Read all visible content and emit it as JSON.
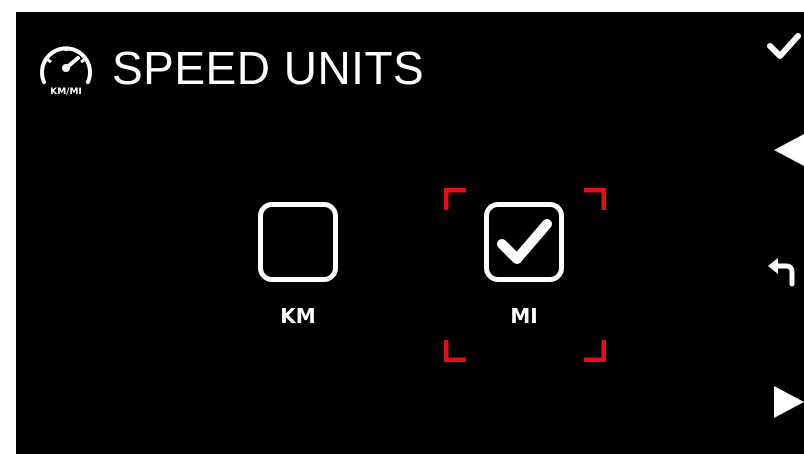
{
  "header": {
    "title": "SPEED UNITS",
    "icon": "speedometer-icon",
    "icon_caption": "KM/MI"
  },
  "options": [
    {
      "label": "KM",
      "checked": false
    },
    {
      "label": "MI",
      "checked": true
    }
  ],
  "selected_option": "MI",
  "softkeys": [
    {
      "icon": "checkmark-icon"
    },
    {
      "icon": "left-arrow-icon"
    },
    {
      "icon": "back-return-icon"
    },
    {
      "icon": "right-arrow-icon"
    }
  ],
  "colors": {
    "background": "#000000",
    "foreground": "#ffffff",
    "selection": "#e0101a"
  }
}
